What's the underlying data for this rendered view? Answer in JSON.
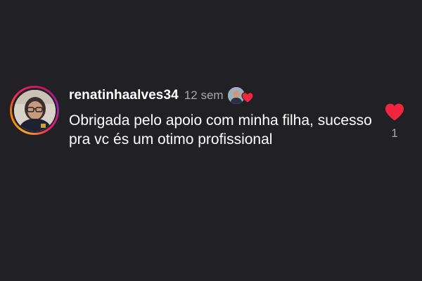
{
  "comment": {
    "username": "renatinhaalves34",
    "time_ago": "12 sem",
    "text": "Obrigada pelo apoio com minha filha, sucesso pra vc és um otimo profissional",
    "likes": "1",
    "liked_by_creator": true
  },
  "icons": {
    "like": "heart-icon",
    "creator_like": "heart-icon"
  },
  "colors": {
    "background": "#212025",
    "heart": "#f0263f",
    "secondary_text": "#a8a8ae"
  }
}
